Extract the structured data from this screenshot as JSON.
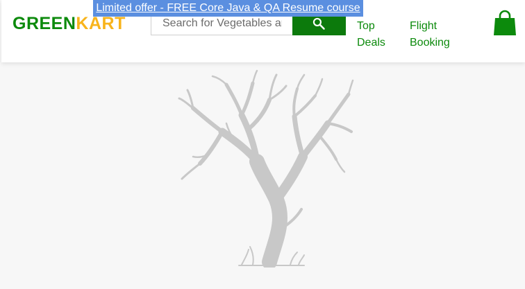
{
  "promo": {
    "text": "Limited offer - FREE Core Java & QA Resume course"
  },
  "logo": {
    "part1": "GREEN",
    "part2": "KART"
  },
  "search": {
    "placeholder": "Search for Vegetables and Fruits",
    "button_icon": "search-icon"
  },
  "nav": [
    {
      "line1": "Top",
      "line2": "Deals"
    },
    {
      "line1": "Flight",
      "line2": "Booking"
    }
  ],
  "cart": {
    "icon": "shopping-bag-icon"
  },
  "colors": {
    "brand_green": "#0c8a0c",
    "brand_yellow": "#f8b41c",
    "search_button": "#0c7a0c",
    "promo_bg": "#5b8fe0",
    "tree": "#c8c8c8"
  }
}
